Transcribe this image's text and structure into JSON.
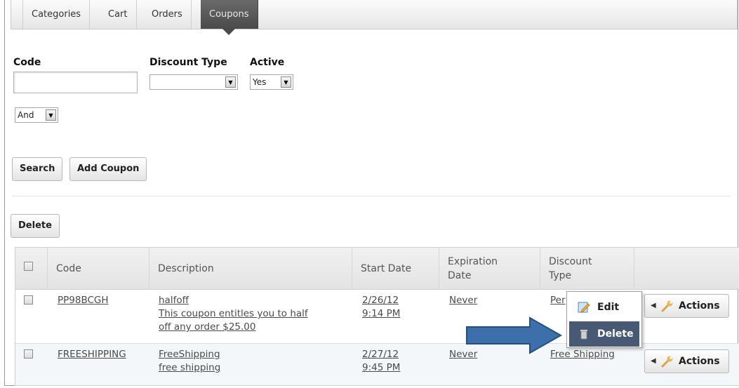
{
  "tabs": [
    "Categories",
    "Cart",
    "Orders",
    "Coupons"
  ],
  "filters": {
    "code_label": "Code",
    "code_value": "",
    "discount_type_label": "Discount Type",
    "discount_type_value": "",
    "active_label": "Active",
    "active_value": "Yes",
    "operator_value": "And"
  },
  "buttons": {
    "search": "Search",
    "add_coupon": "Add Coupon",
    "delete": "Delete"
  },
  "table": {
    "headers": {
      "code": "Code",
      "description": "Description",
      "start_date": "Start Date",
      "expiration_line1": "Expiration",
      "expiration_line2": "Date",
      "discount_line1": "Discount",
      "discount_line2": "Type"
    },
    "rows": [
      {
        "code": "PP98BCGH",
        "desc_line1": "halfoff",
        "desc_line2": "This coupon entitles you to half",
        "desc_line3": "off any order $25.00",
        "start_line1": "2/26/12",
        "start_line2": "9:14 PM",
        "expiration": "Never",
        "discount_type": "Per",
        "actions_label": "Actions"
      },
      {
        "code": "FREESHIPPING",
        "desc_line1": "FreeShipping",
        "desc_line2": "free shipping",
        "start_line1": "2/27/12",
        "start_line2": "9:45 PM",
        "expiration": "Never",
        "discount_type": "Free Shipping",
        "actions_label": "Actions"
      }
    ]
  },
  "context_menu": {
    "edit": "Edit",
    "delete": "Delete"
  },
  "colors": {
    "menu_highlight": "#485a73",
    "arrow_fill": "#3d6faa"
  }
}
